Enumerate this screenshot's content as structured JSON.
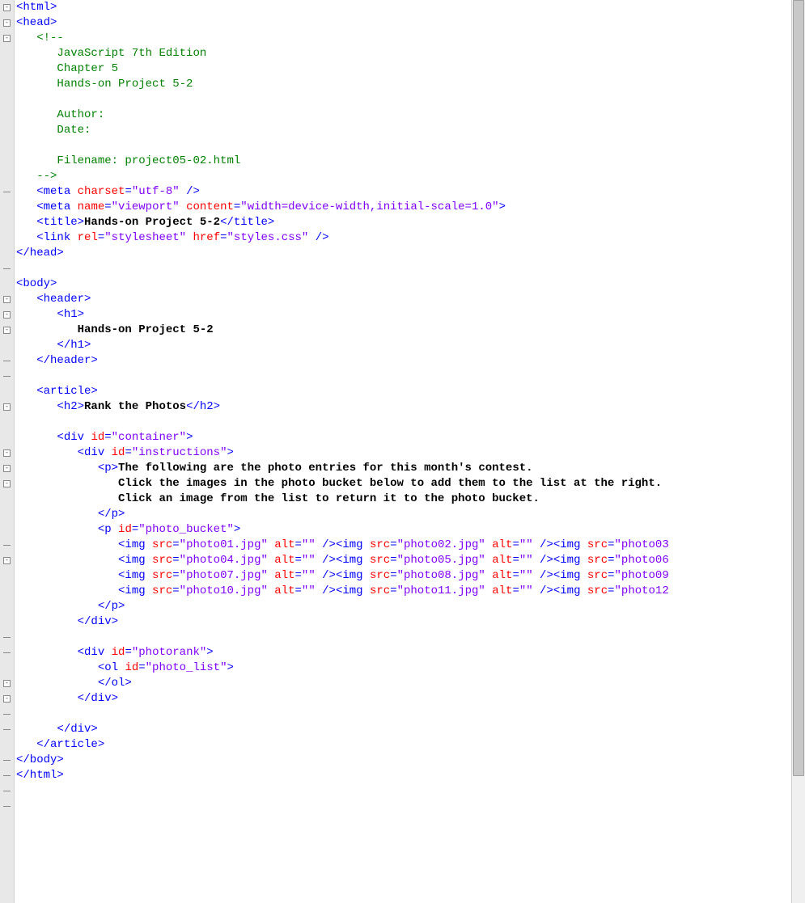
{
  "fold_markers": [
    {
      "line": 0,
      "type": "box"
    },
    {
      "line": 1,
      "type": "box"
    },
    {
      "line": 2,
      "type": "box"
    },
    {
      "line": 12,
      "type": "end"
    },
    {
      "line": 17,
      "type": "end"
    },
    {
      "line": 19,
      "type": "box"
    },
    {
      "line": 20,
      "type": "box"
    },
    {
      "line": 21,
      "type": "box"
    },
    {
      "line": 23,
      "type": "end"
    },
    {
      "line": 24,
      "type": "end"
    },
    {
      "line": 26,
      "type": "box"
    },
    {
      "line": 29,
      "type": "box"
    },
    {
      "line": 30,
      "type": "box"
    },
    {
      "line": 31,
      "type": "box"
    },
    {
      "line": 35,
      "type": "end"
    },
    {
      "line": 36,
      "type": "box"
    },
    {
      "line": 41,
      "type": "end"
    },
    {
      "line": 42,
      "type": "end"
    },
    {
      "line": 44,
      "type": "box"
    },
    {
      "line": 45,
      "type": "box"
    },
    {
      "line": 46,
      "type": "end"
    },
    {
      "line": 47,
      "type": "end"
    },
    {
      "line": 49,
      "type": "end"
    },
    {
      "line": 50,
      "type": "end"
    },
    {
      "line": 51,
      "type": "end"
    },
    {
      "line": 52,
      "type": "end"
    }
  ],
  "code_lines": [
    [
      [
        "tag",
        "<html>"
      ]
    ],
    [
      [
        "tag",
        "<head>"
      ]
    ],
    [
      [
        "plain",
        "   "
      ],
      [
        "comment",
        "<!--"
      ]
    ],
    [
      [
        "plain",
        "      "
      ],
      [
        "comment",
        "JavaScript 7th Edition"
      ]
    ],
    [
      [
        "plain",
        "      "
      ],
      [
        "comment",
        "Chapter 5"
      ]
    ],
    [
      [
        "plain",
        "      "
      ],
      [
        "comment",
        "Hands-on Project 5-2"
      ]
    ],
    [
      [
        "plain",
        ""
      ]
    ],
    [
      [
        "plain",
        "      "
      ],
      [
        "comment",
        "Author:"
      ]
    ],
    [
      [
        "plain",
        "      "
      ],
      [
        "comment",
        "Date:"
      ]
    ],
    [
      [
        "plain",
        ""
      ]
    ],
    [
      [
        "plain",
        "      "
      ],
      [
        "comment",
        "Filename: project05-02.html"
      ]
    ],
    [
      [
        "plain",
        "   "
      ],
      [
        "comment",
        "-->"
      ]
    ],
    [
      [
        "plain",
        "   "
      ],
      [
        "tag",
        "<meta "
      ],
      [
        "attr",
        "charset"
      ],
      [
        "tag",
        "="
      ],
      [
        "str",
        "\"utf-8\""
      ],
      [
        "tag",
        " />"
      ]
    ],
    [
      [
        "plain",
        "   "
      ],
      [
        "tag",
        "<meta "
      ],
      [
        "attr",
        "name"
      ],
      [
        "tag",
        "="
      ],
      [
        "str",
        "\"viewport\""
      ],
      [
        "tag",
        " "
      ],
      [
        "attr",
        "content"
      ],
      [
        "tag",
        "="
      ],
      [
        "str",
        "\"width=device-width,initial-scale=1.0\""
      ],
      [
        "tag",
        ">"
      ]
    ],
    [
      [
        "plain",
        "   "
      ],
      [
        "tag",
        "<title>"
      ],
      [
        "black",
        "Hands-on Project 5-2"
      ],
      [
        "tag",
        "</title>"
      ]
    ],
    [
      [
        "plain",
        "   "
      ],
      [
        "tag",
        "<link "
      ],
      [
        "attr",
        "rel"
      ],
      [
        "tag",
        "="
      ],
      [
        "str",
        "\"stylesheet\""
      ],
      [
        "tag",
        " "
      ],
      [
        "attr",
        "href"
      ],
      [
        "tag",
        "="
      ],
      [
        "str",
        "\"styles.css\""
      ],
      [
        "tag",
        " />"
      ]
    ],
    [
      [
        "tag",
        "</head>"
      ]
    ],
    [
      [
        "plain",
        ""
      ]
    ],
    [
      [
        "tag",
        "<body>"
      ]
    ],
    [
      [
        "plain",
        "   "
      ],
      [
        "tag",
        "<header>"
      ]
    ],
    [
      [
        "plain",
        "      "
      ],
      [
        "tag",
        "<h1>"
      ]
    ],
    [
      [
        "plain",
        "         "
      ],
      [
        "black",
        "Hands-on Project 5-2"
      ]
    ],
    [
      [
        "plain",
        "      "
      ],
      [
        "tag",
        "</h1>"
      ]
    ],
    [
      [
        "plain",
        "   "
      ],
      [
        "tag",
        "</header>"
      ]
    ],
    [
      [
        "plain",
        ""
      ]
    ],
    [
      [
        "plain",
        "   "
      ],
      [
        "tag",
        "<article>"
      ]
    ],
    [
      [
        "plain",
        "      "
      ],
      [
        "tag",
        "<h2>"
      ],
      [
        "black",
        "Rank the Photos"
      ],
      [
        "tag",
        "</h2>"
      ]
    ],
    [
      [
        "plain",
        ""
      ]
    ],
    [
      [
        "plain",
        "      "
      ],
      [
        "tag",
        "<div "
      ],
      [
        "attr",
        "id"
      ],
      [
        "tag",
        "="
      ],
      [
        "str",
        "\"container\""
      ],
      [
        "tag",
        ">"
      ]
    ],
    [
      [
        "plain",
        "         "
      ],
      [
        "tag",
        "<div "
      ],
      [
        "attr",
        "id"
      ],
      [
        "tag",
        "="
      ],
      [
        "str",
        "\"instructions\""
      ],
      [
        "tag",
        ">"
      ]
    ],
    [
      [
        "plain",
        "            "
      ],
      [
        "tag",
        "<p>"
      ],
      [
        "black",
        "The following are the photo entries for this month's contest."
      ]
    ],
    [
      [
        "plain",
        "               "
      ],
      [
        "black",
        "Click the images in the photo bucket below to add them to the list at the right."
      ]
    ],
    [
      [
        "plain",
        "               "
      ],
      [
        "black",
        "Click an image from the list to return it to the photo bucket."
      ]
    ],
    [
      [
        "plain",
        "            "
      ],
      [
        "tag",
        "</p>"
      ]
    ],
    [
      [
        "plain",
        "            "
      ],
      [
        "tag",
        "<p "
      ],
      [
        "attr",
        "id"
      ],
      [
        "tag",
        "="
      ],
      [
        "str",
        "\"photo_bucket\""
      ],
      [
        "tag",
        ">"
      ]
    ],
    [
      [
        "plain",
        "               "
      ],
      [
        "tag",
        "<img "
      ],
      [
        "attr",
        "src"
      ],
      [
        "tag",
        "="
      ],
      [
        "str",
        "\"photo01.jpg\""
      ],
      [
        "tag",
        " "
      ],
      [
        "attr",
        "alt"
      ],
      [
        "tag",
        "="
      ],
      [
        "str",
        "\"\""
      ],
      [
        "tag",
        " />"
      ],
      [
        "tag",
        "<img "
      ],
      [
        "attr",
        "src"
      ],
      [
        "tag",
        "="
      ],
      [
        "str",
        "\"photo02.jpg\""
      ],
      [
        "tag",
        " "
      ],
      [
        "attr",
        "alt"
      ],
      [
        "tag",
        "="
      ],
      [
        "str",
        "\"\""
      ],
      [
        "tag",
        " />"
      ],
      [
        "tag",
        "<img "
      ],
      [
        "attr",
        "src"
      ],
      [
        "tag",
        "="
      ],
      [
        "str",
        "\"photo03"
      ]
    ],
    [
      [
        "plain",
        "               "
      ],
      [
        "tag",
        "<img "
      ],
      [
        "attr",
        "src"
      ],
      [
        "tag",
        "="
      ],
      [
        "str",
        "\"photo04.jpg\""
      ],
      [
        "tag",
        " "
      ],
      [
        "attr",
        "alt"
      ],
      [
        "tag",
        "="
      ],
      [
        "str",
        "\"\""
      ],
      [
        "tag",
        " />"
      ],
      [
        "tag",
        "<img "
      ],
      [
        "attr",
        "src"
      ],
      [
        "tag",
        "="
      ],
      [
        "str",
        "\"photo05.jpg\""
      ],
      [
        "tag",
        " "
      ],
      [
        "attr",
        "alt"
      ],
      [
        "tag",
        "="
      ],
      [
        "str",
        "\"\""
      ],
      [
        "tag",
        " />"
      ],
      [
        "tag",
        "<img "
      ],
      [
        "attr",
        "src"
      ],
      [
        "tag",
        "="
      ],
      [
        "str",
        "\"photo06"
      ]
    ],
    [
      [
        "plain",
        "               "
      ],
      [
        "tag",
        "<img "
      ],
      [
        "attr",
        "src"
      ],
      [
        "tag",
        "="
      ],
      [
        "str",
        "\"photo07.jpg\""
      ],
      [
        "tag",
        " "
      ],
      [
        "attr",
        "alt"
      ],
      [
        "tag",
        "="
      ],
      [
        "str",
        "\"\""
      ],
      [
        "tag",
        " />"
      ],
      [
        "tag",
        "<img "
      ],
      [
        "attr",
        "src"
      ],
      [
        "tag",
        "="
      ],
      [
        "str",
        "\"photo08.jpg\""
      ],
      [
        "tag",
        " "
      ],
      [
        "attr",
        "alt"
      ],
      [
        "tag",
        "="
      ],
      [
        "str",
        "\"\""
      ],
      [
        "tag",
        " />"
      ],
      [
        "tag",
        "<img "
      ],
      [
        "attr",
        "src"
      ],
      [
        "tag",
        "="
      ],
      [
        "str",
        "\"photo09"
      ]
    ],
    [
      [
        "plain",
        "               "
      ],
      [
        "tag",
        "<img "
      ],
      [
        "attr",
        "src"
      ],
      [
        "tag",
        "="
      ],
      [
        "str",
        "\"photo10.jpg\""
      ],
      [
        "tag",
        " "
      ],
      [
        "attr",
        "alt"
      ],
      [
        "tag",
        "="
      ],
      [
        "str",
        "\"\""
      ],
      [
        "tag",
        " />"
      ],
      [
        "tag",
        "<img "
      ],
      [
        "attr",
        "src"
      ],
      [
        "tag",
        "="
      ],
      [
        "str",
        "\"photo11.jpg\""
      ],
      [
        "tag",
        " "
      ],
      [
        "attr",
        "alt"
      ],
      [
        "tag",
        "="
      ],
      [
        "str",
        "\"\""
      ],
      [
        "tag",
        " />"
      ],
      [
        "tag",
        "<img "
      ],
      [
        "attr",
        "src"
      ],
      [
        "tag",
        "="
      ],
      [
        "str",
        "\"photo12"
      ]
    ],
    [
      [
        "plain",
        "            "
      ],
      [
        "tag",
        "</p>"
      ]
    ],
    [
      [
        "plain",
        "         "
      ],
      [
        "tag",
        "</div>"
      ]
    ],
    [
      [
        "plain",
        ""
      ]
    ],
    [
      [
        "plain",
        "         "
      ],
      [
        "tag",
        "<div "
      ],
      [
        "attr",
        "id"
      ],
      [
        "tag",
        "="
      ],
      [
        "str",
        "\"photorank\""
      ],
      [
        "tag",
        ">"
      ]
    ],
    [
      [
        "plain",
        "            "
      ],
      [
        "tag",
        "<ol "
      ],
      [
        "attr",
        "id"
      ],
      [
        "tag",
        "="
      ],
      [
        "str",
        "\"photo_list\""
      ],
      [
        "tag",
        ">"
      ]
    ],
    [
      [
        "plain",
        "            "
      ],
      [
        "tag",
        "</ol>"
      ]
    ],
    [
      [
        "plain",
        "         "
      ],
      [
        "tag",
        "</div>"
      ]
    ],
    [
      [
        "plain",
        ""
      ]
    ],
    [
      [
        "plain",
        "      "
      ],
      [
        "tag",
        "</div>"
      ]
    ],
    [
      [
        "plain",
        "   "
      ],
      [
        "tag",
        "</article>"
      ]
    ],
    [
      [
        "tag",
        "</body>"
      ]
    ],
    [
      [
        "tag",
        "</html>"
      ]
    ]
  ],
  "scroll_thumb_height": 960
}
